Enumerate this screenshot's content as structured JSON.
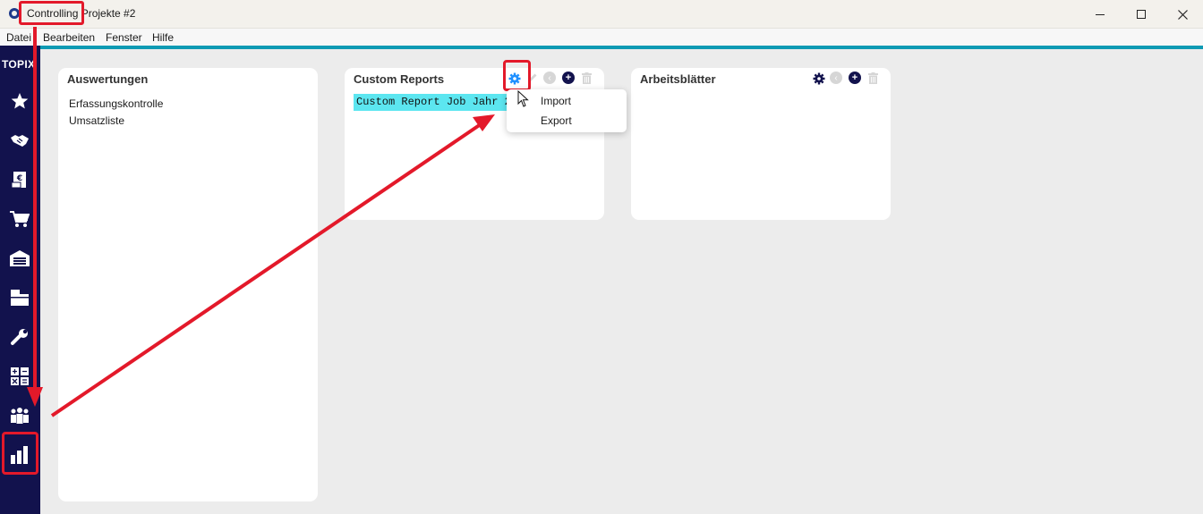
{
  "window": {
    "title": "Controlling Projekte #2"
  },
  "menu": {
    "items": [
      "Datei",
      "Bearbeiten",
      "Fenster",
      "Hilfe"
    ]
  },
  "sidebar": {
    "brand": "TOPIX",
    "icons": [
      "star-icon",
      "handshake-icon",
      "invoice-icon",
      "cart-icon",
      "warehouse-icon",
      "archive-icon",
      "wrench-icon",
      "calculator-icon",
      "people-icon",
      "bar-chart-icon"
    ]
  },
  "panels": {
    "auswertungen": {
      "title": "Auswertungen",
      "items": [
        "Erfassungskontrolle",
        "Umsatzliste"
      ]
    },
    "custom_reports": {
      "title": "Custom Reports",
      "selected_item": "Custom Report Job Jahr 202"
    },
    "arbeitsblaetter": {
      "title": "Arbeitsblätter"
    }
  },
  "popup": {
    "items": [
      "Import",
      "Export"
    ]
  },
  "colors": {
    "accent": "#0e9ab3",
    "sidebar": "#12124d",
    "highlight": "#e3192a",
    "selection": "#5ce6f0",
    "gear_active": "#1e90ff"
  }
}
